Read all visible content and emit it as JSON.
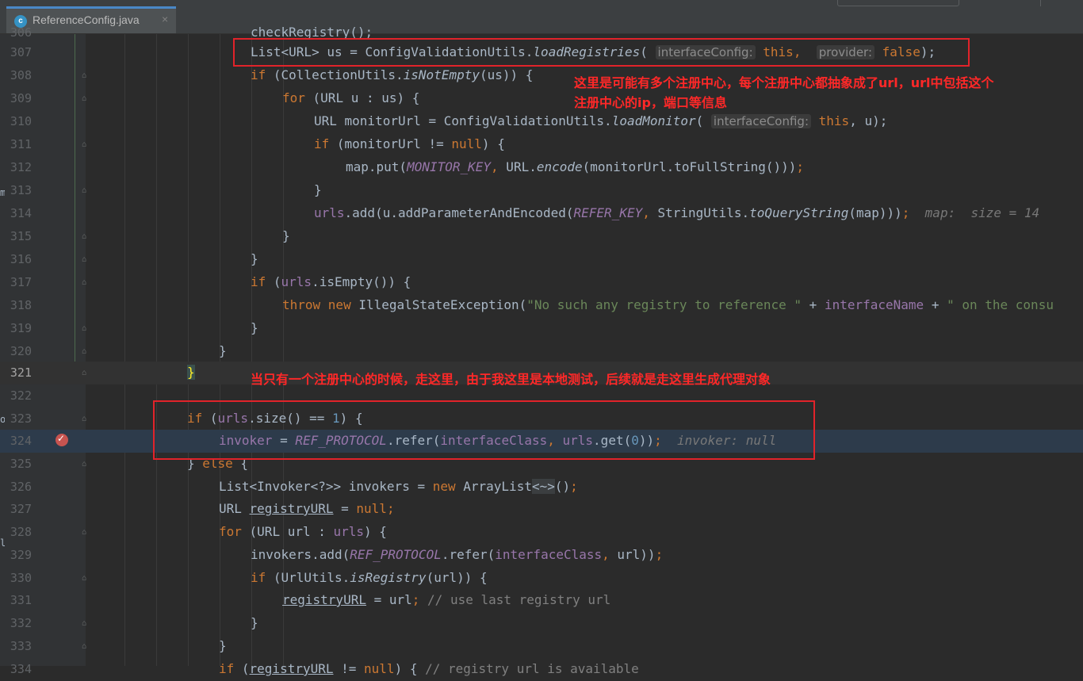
{
  "tab": {
    "icon_letter": "c",
    "filename": "ReferenceConfig.java",
    "close_glyph": "×"
  },
  "lines": [
    {
      "number": "306",
      "text": "checkRegistry();"
    },
    {
      "number": "307",
      "text": "List<URL> us = ConfigValidationUtils.loadRegistries( interfaceConfig: this,  provider: false);"
    },
    {
      "number": "308",
      "text": "if (CollectionUtils.isNotEmpty(us)) {"
    },
    {
      "number": "309",
      "text": "for (URL u : us) {"
    },
    {
      "number": "310",
      "text": "URL monitorUrl = ConfigValidationUtils.loadMonitor( interfaceConfig: this, u);"
    },
    {
      "number": "311",
      "text": "if (monitorUrl != null) {"
    },
    {
      "number": "312",
      "text": "map.put(MONITOR_KEY, URL.encode(monitorUrl.toFullString()));"
    },
    {
      "number": "313",
      "text": "}"
    },
    {
      "number": "314",
      "text": "urls.add(u.addParameterAndEncoded(REFER_KEY, StringUtils.toQueryString(map)));  map:  size = 14"
    },
    {
      "number": "315",
      "text": "}"
    },
    {
      "number": "316",
      "text": "}"
    },
    {
      "number": "317",
      "text": "if (urls.isEmpty()) {"
    },
    {
      "number": "318",
      "text": "throw new IllegalStateException(\"No such any registry to reference \" + interfaceName + \" on the consu"
    },
    {
      "number": "319",
      "text": "}"
    },
    {
      "number": "320",
      "text": "}"
    },
    {
      "number": "321",
      "text": "}"
    },
    {
      "number": "322",
      "text": ""
    },
    {
      "number": "323",
      "text": "if (urls.size() == 1) {"
    },
    {
      "number": "324",
      "text": "invoker = REF_PROTOCOL.refer(interfaceClass, urls.get(0));  invoker: null"
    },
    {
      "number": "325",
      "text": "} else {"
    },
    {
      "number": "326",
      "text": "List<Invoker<?>> invokers = new ArrayList<~>();"
    },
    {
      "number": "327",
      "text": "URL registryURL = null;"
    },
    {
      "number": "328",
      "text": "for (URL url : urls) {"
    },
    {
      "number": "329",
      "text": "invokers.add(REF_PROTOCOL.refer(interfaceClass, url));"
    },
    {
      "number": "330",
      "text": "if (UrlUtils.isRegistry(url)) {"
    },
    {
      "number": "331",
      "text": "registryURL = url; // use last registry url"
    },
    {
      "number": "332",
      "text": "}"
    },
    {
      "number": "333",
      "text": "}"
    },
    {
      "number": "334",
      "text": "if (registryURL != null) { // registry url is available"
    }
  ],
  "annotations": {
    "note1_line1": "这里是可能有多个注册中心，每个注册中心都抽象成了url，url中包括这个",
    "note1_line2": "注册中心的ip，端口等信息",
    "note2": "当只有一个注册中心的时候，走这里，由于我这里是本地测试，后续就是走这里生成代理对象",
    "color": "#E1232A"
  },
  "side_marks": [
    "m",
    "o",
    "l"
  ],
  "theme": {
    "background": "#2B2B2B",
    "keyword": "#CC7832",
    "string": "#6A8759",
    "field": "#9876AA",
    "number": "#6897BB",
    "breakpoint": "#C75450"
  }
}
